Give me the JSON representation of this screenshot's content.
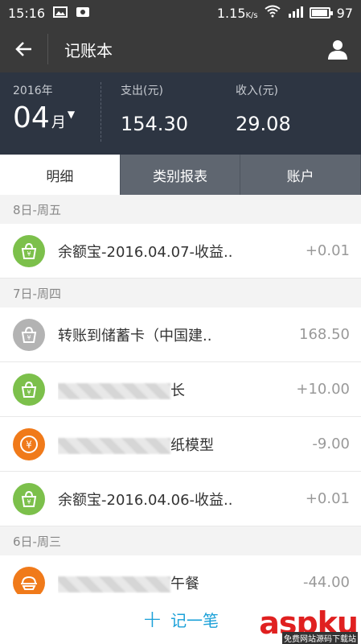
{
  "status_bar": {
    "time": "15:16",
    "speed": "1.15",
    "speed_unit": "K/s",
    "battery": "97",
    "battery_level": 0.97
  },
  "app_bar": {
    "title": "记账本"
  },
  "summary": {
    "year_label": "2016年",
    "month": "04",
    "month_unit": "月",
    "expense_label": "支出(元)",
    "expense": "154.30",
    "income_label": "收入(元)",
    "income": "29.08"
  },
  "tabs": [
    {
      "label": "明细",
      "active": true
    },
    {
      "label": "类别报表",
      "active": false
    },
    {
      "label": "账户",
      "active": false
    }
  ],
  "days": [
    {
      "label": "8日-周五",
      "items": [
        {
          "name": "余额宝-2016.04.07-收益..",
          "amount": "+0.01",
          "icon": "yuebao-icon",
          "color": "#7cc04b"
        }
      ]
    },
    {
      "label": "7日-周四",
      "items": [
        {
          "name": "转账到储蓄卡（中国建..",
          "amount": "168.50",
          "icon": "transfer-icon",
          "color": "#b3b3b3"
        },
        {
          "name": "长",
          "amount": "+10.00",
          "icon": "yuebao-icon",
          "color": "#7cc04b"
        },
        {
          "name": "纸模型",
          "amount": "-9.00",
          "icon": "coin-icon",
          "color": "#f07a1a"
        },
        {
          "name": "余额宝-2016.04.06-收益..",
          "amount": "+0.01",
          "icon": "yuebao-icon",
          "color": "#7cc04b"
        }
      ]
    },
    {
      "label": "6日-周三",
      "items": [
        {
          "name": "午餐",
          "amount": "-44.00",
          "icon": "food-icon",
          "color": "#f07a1a"
        }
      ]
    }
  ],
  "bottom": {
    "label": "记一笔"
  },
  "watermark": {
    "text": "aspku",
    "sub": "免费网站源码下载站"
  }
}
